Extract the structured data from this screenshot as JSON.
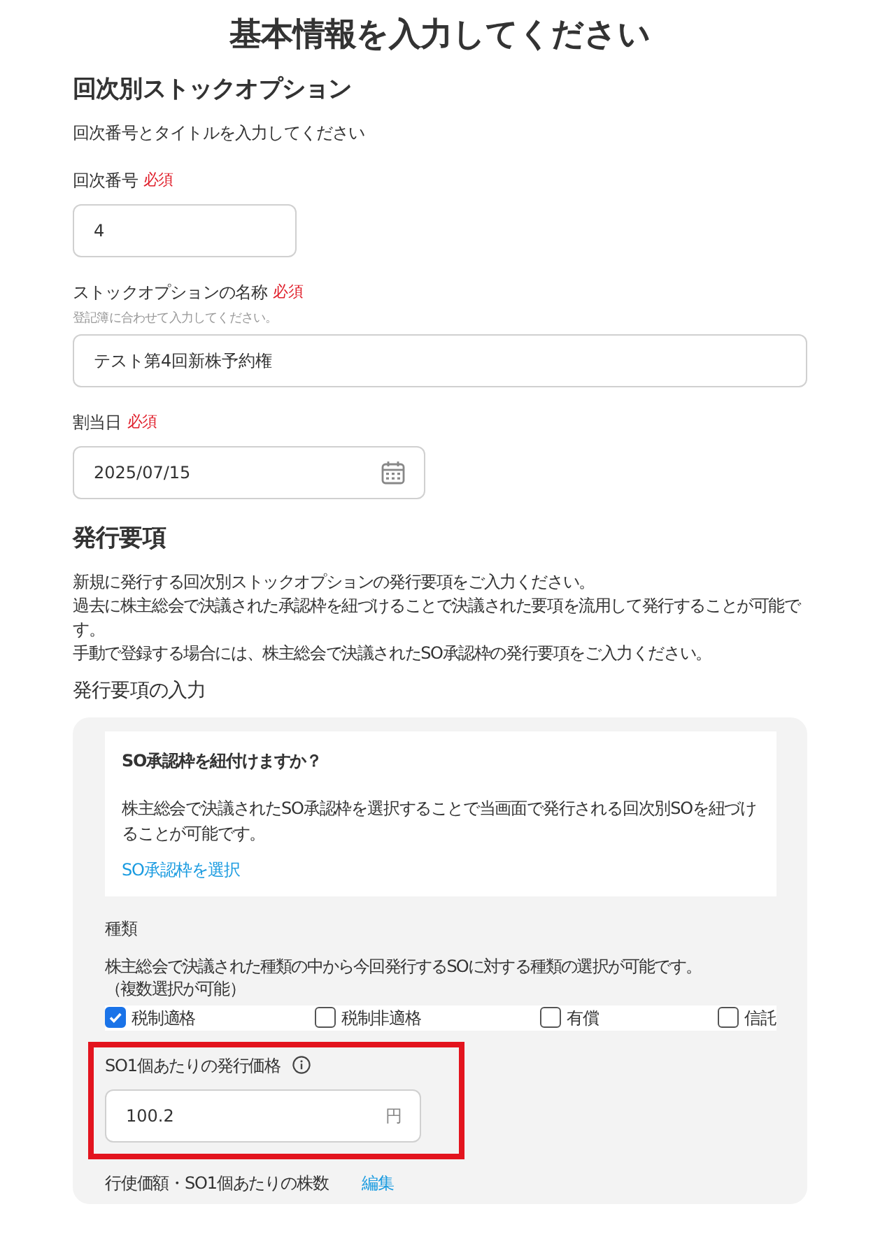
{
  "title": "基本情報を入力してください",
  "round_section": {
    "heading": "回次別ストックオプション",
    "description": "回次番号とタイトルを入力してください",
    "fields": [
      {
        "kind": "number",
        "label": "回次番号",
        "required_mark": "必須",
        "value": "4"
      },
      {
        "kind": "text",
        "label": "ストックオプションの名称",
        "required_mark": "必須",
        "hint": "登記簿に合わせて入力してください。",
        "value": "テスト第4回新株予約権"
      },
      {
        "kind": "date",
        "label": "割当日",
        "required_mark": "必須",
        "value": "2025/07/15"
      }
    ]
  },
  "issuance_section": {
    "heading": "発行要項",
    "description_lines": [
      "新規に発行する回次別ストックオプションの発行要項をご入力ください。",
      "過去に株主総会で決議された承認枠を紐づけることで決議された要項を流用して発行することが可能です。",
      "手動で登録する場合には、株主総会で決議されたSO承認枠の発行要項をご入力ください。"
    ],
    "subheading": "発行要項の入力",
    "link_card": {
      "title": "SO承認枠を紐付けますか？",
      "text": "株主総会で決議されたSO承認枠を選択することで当画面で発行される回次別SOを紐づけることが可能です。",
      "link": "SO承認枠を選択"
    },
    "types": {
      "label": "種類",
      "description_lines": [
        "株主総会で決議された種類の中から今回発行するSOに対する種類の選択が可能です。",
        "（複数選択が可能）"
      ],
      "options": [
        {
          "label": "税制適格",
          "checked": true
        },
        {
          "label": "税制非適格",
          "checked": false
        },
        {
          "label": "有償",
          "checked": false
        },
        {
          "label": "信託",
          "checked": false
        }
      ]
    },
    "price_field": {
      "label": "SO1個あたりの発行価格",
      "value": "100.2",
      "unit": "円",
      "highlighted": true
    },
    "exercise_row": {
      "label": "行使価額・SO1個あたりの株数",
      "link": "編集"
    }
  }
}
